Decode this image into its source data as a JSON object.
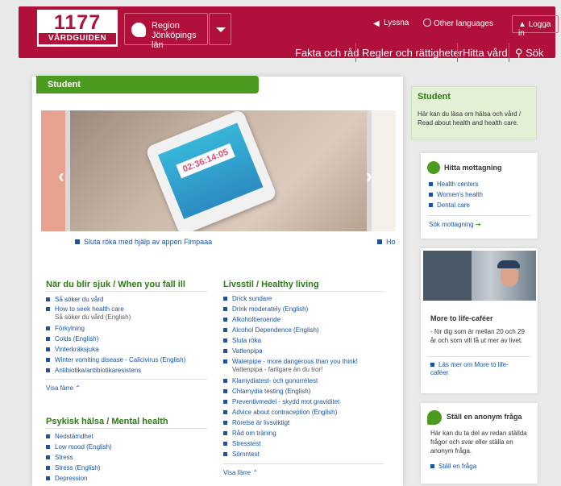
{
  "header": {
    "logo_number": "1177",
    "logo_sub": "VÅRDGUIDEN",
    "region_line1": "Region",
    "region_line2": "Jönköpings län",
    "listen": "Lyssna",
    "other_languages": "Other languages",
    "login": "Logga in",
    "nav": [
      "Fakta och råd",
      "Regler och rättigheter",
      "Hitta vård",
      "Sök"
    ],
    "brand_color": "#b0103a"
  },
  "main": {
    "section_title": "Student",
    "carousel_caption": "Sluta röka med hjälp av appen Fimpaaa",
    "carousel_caption2": "Ho",
    "timer_text": "02:36:14:05",
    "sick": {
      "title": "När du blir sjuk / When you fall ill",
      "links": [
        "Så söker du vård",
        "How to seek health care",
        "Förkylning",
        "Colds (English)",
        "Vinterkräksjuka",
        "Winter vomiting disease - Calicivirus (English)",
        "Antibiotika/antibiotikaresistens"
      ],
      "note": "Så söker du vård (English)",
      "more": "Visa färre"
    },
    "mental": {
      "title": "Psykisk hälsa / Mental health",
      "links": [
        "Nedstämdhet",
        "Low mood (English)",
        "Stress",
        "Stress (English)",
        "Depression"
      ]
    },
    "lifestyle": {
      "title": "Livsstil / Healthy living",
      "links": [
        "Drick sundare",
        "Drink moderately (English)",
        "Alkoholberoende",
        "Alcohol Dependence (English)",
        "Sluta röka",
        "Vattenpipa",
        "Waterpipe - more dangerous than you think!",
        "Klamydiatest- och gonorrétest",
        "Chlamydia testing (English)",
        "Preventivmedel - skydd mot graviditet",
        "Advice about contraception (English)",
        "Rörelse är livsviktigt",
        "Råd om träning",
        "Stresstest",
        "Sömntest"
      ],
      "note": "Vattenpipa - farligare än du tror!",
      "more": "Visa färre"
    }
  },
  "sidebar": {
    "info_title": "Student",
    "info_text": "Här kan du läsa om hälsa och vård / Read about health and health care.",
    "find": {
      "title": "Hitta mottagning",
      "links": [
        "Health centers",
        "Women's health",
        "Dental care"
      ],
      "search": "Sök mottagning"
    },
    "cafe": {
      "title": "More to life-caféer",
      "text": "- för dig som är mellan 20 och 29 år och som vill få ut mer av livet.",
      "link": "Läs mer om More to life-caféer"
    },
    "ask": {
      "title": "Ställ en anonym fråga",
      "text": "Här kan du ta del av redan ställda frågor och svar eller ställa en anonym fråga.",
      "link": "Ställ en fråga"
    }
  }
}
